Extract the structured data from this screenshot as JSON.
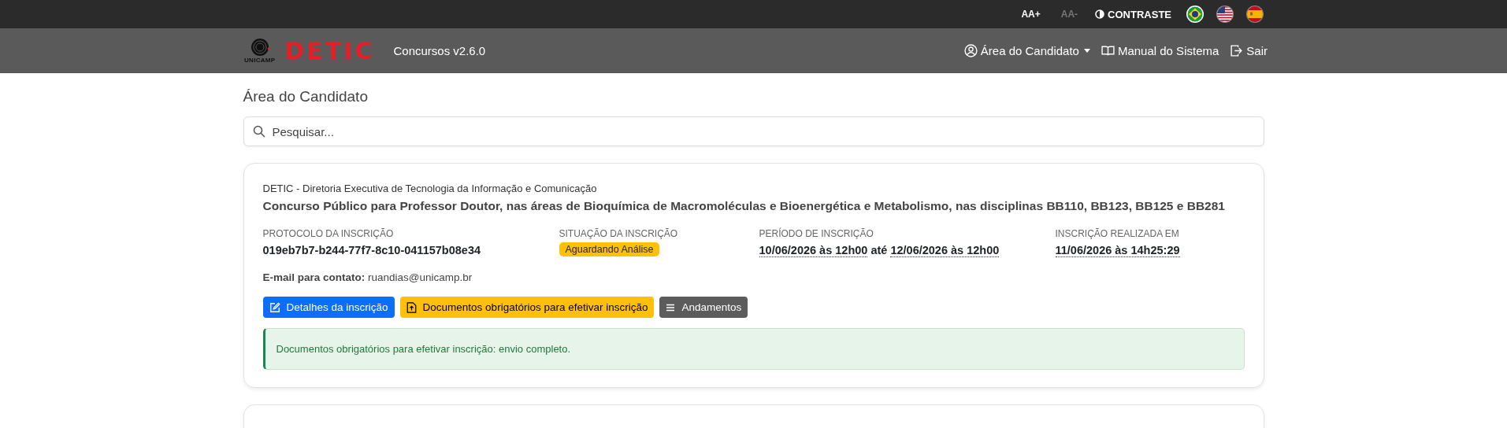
{
  "accessibility_bar": {
    "font_buttons": [
      {
        "label": "AA+",
        "disabled": false
      },
      {
        "label": "AA-",
        "disabled": true
      }
    ],
    "contrast_label": "CONTRASTE",
    "languages": [
      {
        "kind": "brazil"
      },
      {
        "kind": "usa"
      },
      {
        "kind": "spain"
      }
    ]
  },
  "navbar": {
    "emblem_caption": "UNICAMP",
    "logo_text": "DETIC",
    "app_name": "Concursos v2.6.0",
    "links": [
      {
        "kind": "user",
        "label": "Área do Candidato",
        "dropdown": true
      },
      {
        "kind": "book",
        "label": "Manual do Sistema",
        "dropdown": false
      },
      {
        "kind": "logout",
        "label": "Sair",
        "dropdown": false
      }
    ]
  },
  "page_title": "Área do Candidato",
  "search": {
    "placeholder": "Pesquisar..."
  },
  "cards": [
    {
      "organization": "DETIC - Diretoria Executiva de Tecnologia da Informação e Comunicação",
      "title": "Concurso Público para Professor Doutor, nas áreas de Bioquímica de Macromoléculas e Bioenergética e Metabolismo, nas disciplinas BB110, BB123, BB125 e BB281",
      "fields": [
        {
          "kind": "text",
          "label": "PROTOCOLO DA INSCRIÇÃO",
          "value": "019eb7b7-b244-77f7-8c10-041157b08e34"
        },
        {
          "kind": "badge",
          "label": "SITUAÇÃO DA INSCRIÇÃO",
          "value": "Aguardando Análise",
          "color": "#ffc107"
        },
        {
          "kind": "period",
          "label": "PERÍODO DE INSCRIÇÃO",
          "start": "10/06/2026 às 12h00",
          "connector": "até",
          "end": "12/06/2026 às 12h00"
        },
        {
          "kind": "date",
          "label": "INSCRIÇÃO REALIZADA EM",
          "value": "11/06/2026 às 14h25:29"
        }
      ],
      "email_label": "E-mail para contato:",
      "email": "ruandias@unicamp.br",
      "buttons": [
        {
          "kind": "edit",
          "label": "Detalhes da inscrição"
        },
        {
          "kind": "upload",
          "label": "Documentos obrigatórios para efetivar inscrição"
        },
        {
          "kind": "list",
          "label": "Andamentos"
        }
      ],
      "alert": {
        "text": "Documentos obrigatórios para efetivar inscrição: envio completo."
      }
    },
    {
      "kind": "empty"
    }
  ]
}
